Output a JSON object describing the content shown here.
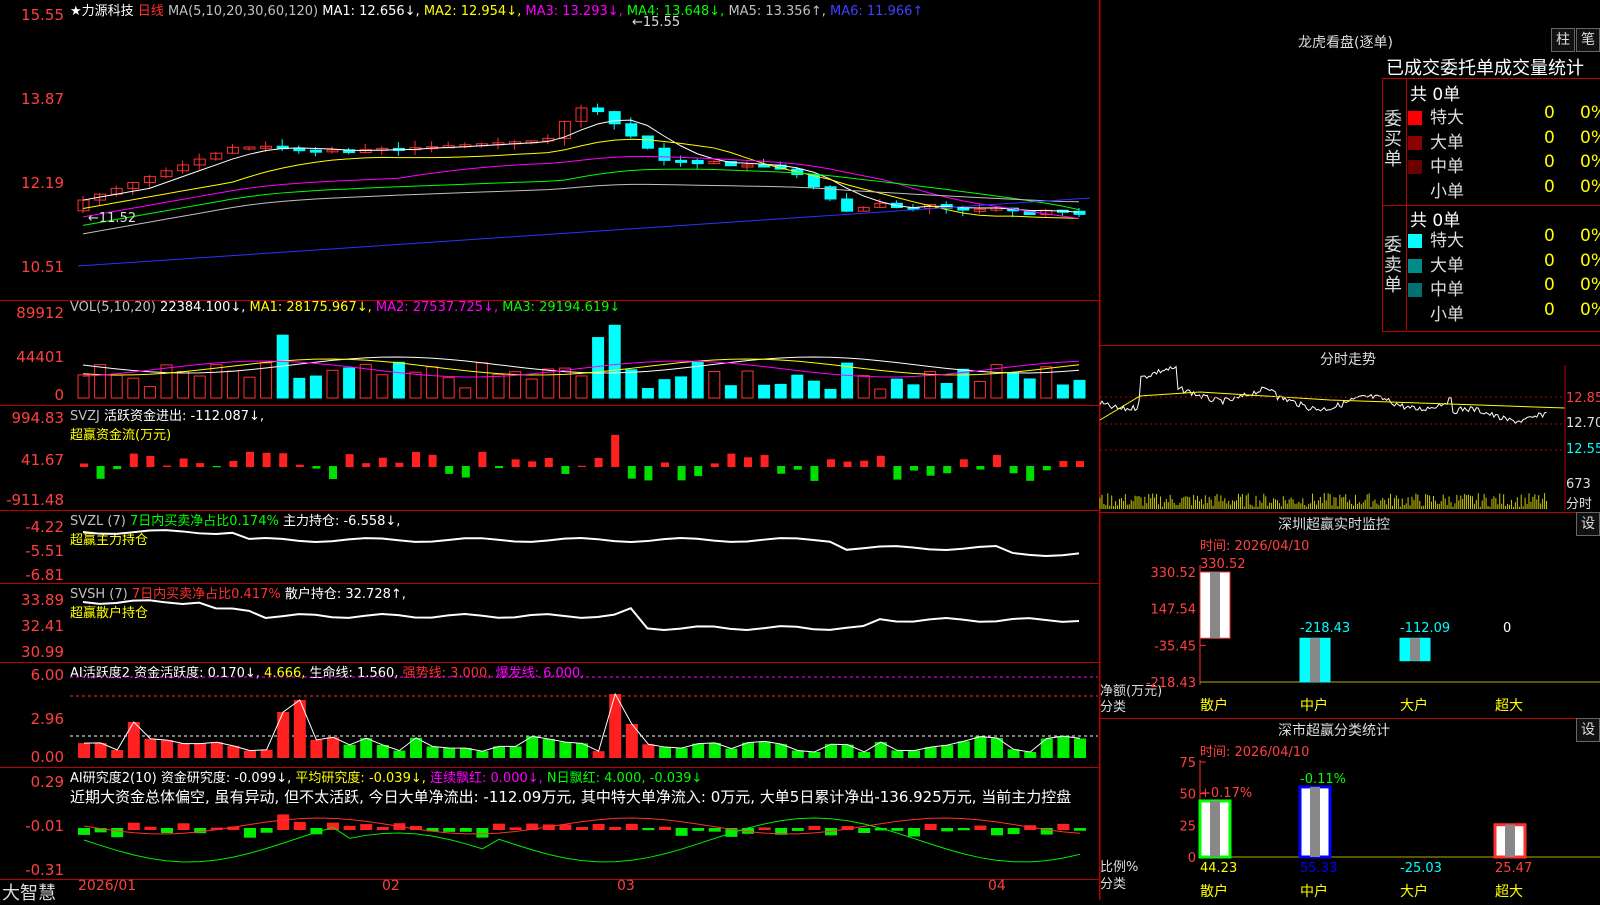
{
  "kline": {
    "title": "★力源科技",
    "period": "日线",
    "ma_label": "MA(5,10,20,30,60,120)",
    "ma1": "MA1: 12.656↓,",
    "ma2": "MA2: 12.954↓,",
    "ma3": "MA3: 13.293↓,",
    "ma4": "MA4: 13.648↓,",
    "ma5": "MA5: 13.356↑,",
    "ma6": "MA6: 11.966↑",
    "high_mark": "15.55",
    "low_mark": "11.52",
    "axis": [
      "15.55",
      "13.87",
      "12.19",
      "10.51"
    ]
  },
  "vol": {
    "label": "VOL(5,10,20)",
    "val": "22384.100↓,",
    "ma1": "MA1: 28175.967↓,",
    "ma2": "MA2: 27537.725↓,",
    "ma3": "MA3: 29194.619↓",
    "axis": [
      "89912",
      "44401",
      "0"
    ]
  },
  "svzj": {
    "label": "SVZJ",
    "text": "活跃资金进出: -112.087↓,",
    "sub": "超赢资金流(万元)",
    "axis": [
      "994.83",
      "41.67",
      "-911.48"
    ]
  },
  "svzl": {
    "label": "SVZL (7)",
    "text1": "7日内买卖净占比0.174%",
    "text2": "主力持仓: -6.558↓,",
    "sub": "超赢主力持仓",
    "axis": [
      "-4.22",
      "-5.51",
      "-6.81"
    ]
  },
  "svsh": {
    "label": "SVSH (7)",
    "text1": "7日内买卖净占比0.417%",
    "text2": "散户持仓: 32.728↑,",
    "sub": "超赢散户持仓",
    "axis": [
      "33.89",
      "32.41",
      "30.99"
    ]
  },
  "ai_active": {
    "label": "AI活跃度2",
    "t1": "资金活跃度: 0.170↓,",
    "t2": "4.666,",
    "t3": "生命线: 1.560,",
    "t4": "强势线: 3.000,",
    "t5": "爆发线: 6.000,",
    "axis": [
      "6.00",
      "2.96",
      "0.00"
    ]
  },
  "ai_research": {
    "label": "AI研究度2(10)",
    "t1": "资金研究度: -0.099↓,",
    "t2": "平均研究度: -0.039↓,",
    "t3": "连续飘红: 0.000↓,",
    "t4": "N日飘红: 4.000, -0.039↓",
    "comment": "近期大资金总体偏空, 虽有异动, 但不太活跃, 今日大单净流出: -112.09万元, 其中特大单净流入: 0万元, 大单5日累计净出-136.925万元, 当前主力控盘",
    "axis": [
      "0.29",
      "-0.01",
      "-0.31"
    ]
  },
  "xaxis": [
    "2026/01",
    "02",
    "03",
    "04"
  ],
  "brand": "大智慧",
  "longhu": {
    "title": "龙虎看盘(逐单)",
    "btn1": "柱",
    "btn2": "笔",
    "subtitle": "已成交委托单成交量统计",
    "buy_label": "委买单",
    "sell_label": "委卖单",
    "buy_total": "共 0单",
    "sell_total": "共 0单",
    "buy_rows": [
      {
        "name": "特大",
        "n": "0",
        "p": "0%",
        "color": "#ff0000"
      },
      {
        "name": "大单",
        "n": "0",
        "p": "0%",
        "color": "#8b0000"
      },
      {
        "name": "中单",
        "n": "0",
        "p": "0%",
        "color": "#6a0000"
      },
      {
        "name": "小单",
        "n": "0",
        "p": "0%",
        "color": "#000000"
      }
    ],
    "sell_rows": [
      {
        "name": "特大",
        "n": "0",
        "p": "0%",
        "color": "#00ffff"
      },
      {
        "name": "大单",
        "n": "0",
        "p": "0%",
        "color": "#008b8b"
      },
      {
        "name": "中单",
        "n": "0",
        "p": "0%",
        "color": "#007070"
      },
      {
        "name": "小单",
        "n": "0",
        "p": "0%",
        "color": "#000000"
      }
    ]
  },
  "intraday": {
    "title": "分时走势",
    "axis": [
      "12.85",
      "12.70",
      "12.55",
      "673"
    ],
    "unit": "分时"
  },
  "sz_monitor": {
    "title": "深圳超赢实时监控",
    "btn": "设",
    "time": "时间: 2026/04/10",
    "axis": [
      "330.52",
      "147.54",
      "-35.45",
      "-218.43"
    ],
    "ylabel1": "净额(万元)",
    "ylabel2": "分类",
    "cats": [
      "散户",
      "中户",
      "大户",
      "超大"
    ],
    "values": [
      "330.52",
      "-218.43",
      "-112.09",
      "0"
    ]
  },
  "sz_class": {
    "title": "深市超赢分类统计",
    "btn": "设",
    "time": "时间: 2026/04/10",
    "axis": [
      "75",
      "50",
      "25",
      "0"
    ],
    "ylabel1": "比例%",
    "ylabel2": "分类",
    "cats": [
      "散户",
      "中户",
      "大户",
      "超大"
    ],
    "top_values": [
      "+0.17%",
      "-0.11%",
      "",
      ""
    ],
    "bottom_values": [
      "44.23",
      "55.33",
      "-25.03",
      "25.47"
    ],
    "pct": [
      44.23,
      55.33,
      0,
      25.47
    ]
  }
}
